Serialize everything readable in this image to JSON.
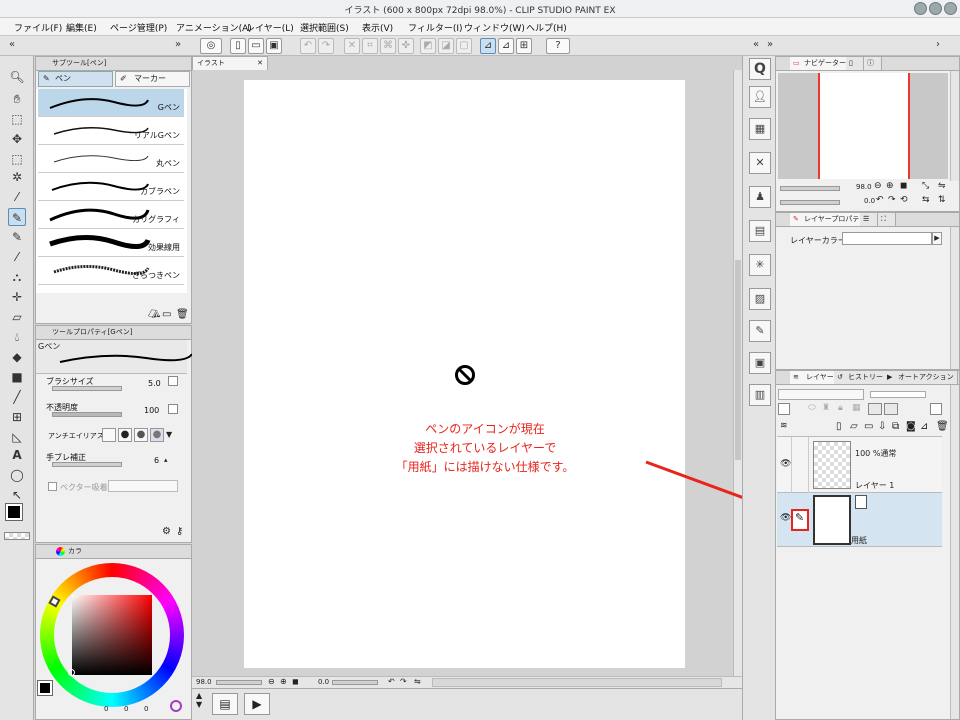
{
  "window": {
    "title": "イラスト (600 x 800px 72dpi 98.0%)  - CLIP STUDIO PAINT EX"
  },
  "menubar": [
    {
      "label": "ファイル(F)"
    },
    {
      "label": "編集(E)"
    },
    {
      "label": "ページ管理(P)"
    },
    {
      "label": "アニメーション(A)"
    },
    {
      "label": "レイヤー(L)"
    },
    {
      "label": "選択範囲(S)"
    },
    {
      "label": "表示(V)"
    },
    {
      "label": "フィルター(I)"
    },
    {
      "label": "ウィンドウ(W)"
    },
    {
      "label": "ヘルプ(H)"
    }
  ],
  "subtool": {
    "header": "サブツール[ペン]",
    "tabs": {
      "pen": "ペン",
      "marker": "マーカー"
    },
    "brushes": [
      {
        "label": "Gペン",
        "selected": true
      },
      {
        "label": "リアルGペン"
      },
      {
        "label": "丸ペン"
      },
      {
        "label": "カブラペン"
      },
      {
        "label": "カリグラフィ"
      },
      {
        "label": "効果線用"
      },
      {
        "label": "ざらつきペン"
      }
    ]
  },
  "toolprop": {
    "header": "ツールプロパティ[Gペン]",
    "brush_name": "Gペン",
    "brush_size": {
      "label": "ブラシサイズ",
      "value": "5.0"
    },
    "opacity": {
      "label": "不透明度",
      "value": "100"
    },
    "antialias": {
      "label": "アンチエイリアス"
    },
    "stabilization": {
      "label": "手ブレ補正",
      "value": "6"
    },
    "vector": {
      "label": "ベクター吸着"
    }
  },
  "color": {
    "header": "カラ",
    "values": {
      "h": "0",
      "s": "0",
      "v": "0"
    }
  },
  "canvas": {
    "tab_label": "イラスト",
    "zoom": "98.0",
    "angle": "0.0",
    "note_lines": [
      "ペンのアイコンが現在",
      "選択されているレイヤーで",
      "「用紙」には描けない仕様です。"
    ]
  },
  "navigator": {
    "tab": "ナビゲーター",
    "zoom": "98.0",
    "angle": "0.0"
  },
  "layer_property": {
    "tab": "レイヤープロパティ",
    "layer_color_label": "レイヤーカラー"
  },
  "layers": {
    "tabs": [
      "レイヤー",
      "ヒストリー",
      "オートアクション"
    ],
    "items": [
      {
        "opacity_blend": "100 %通常",
        "name": "レイヤー 1"
      },
      {
        "name": "用紙",
        "selected": true
      }
    ]
  },
  "colors": {
    "accent": "#5b8db8",
    "note_red": "#e8241c",
    "selected_row": "#d4e4f1"
  }
}
